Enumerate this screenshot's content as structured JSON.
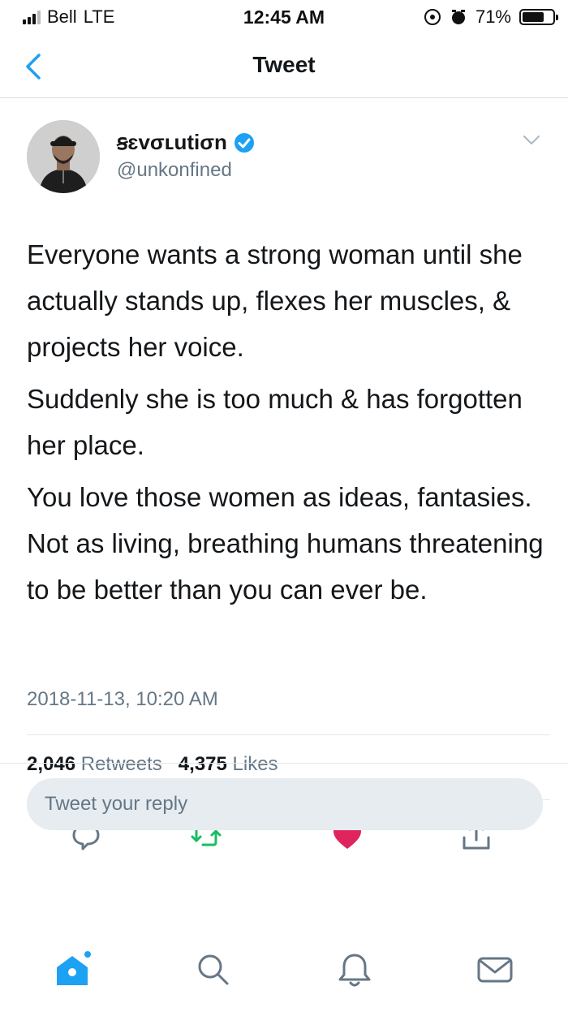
{
  "status_bar": {
    "carrier": "Bell",
    "network": "LTE",
    "time": "12:45 AM",
    "battery": "71%",
    "battery_level": 0.71
  },
  "nav": {
    "title": "Tweet",
    "back_icon": "chevron-left-icon"
  },
  "tweet": {
    "display_name": "ꞩɛvσʟutiσn",
    "handle": "@unkonfined",
    "verified": true,
    "paragraphs": [
      "Everyone wants a strong woman until she actually stands up, flexes her muscles, & projects her voice.",
      "Suddenly she is too much & has forgotten her place.",
      "You love those women as ideas, fantasies. Not as living, breathing humans threatening to be better than you can ever be."
    ],
    "timestamp": "2018-11-13, 10:20 AM",
    "retweets": {
      "count": "2,046",
      "label": "Retweets"
    },
    "likes": {
      "count": "4,375",
      "label": "Likes"
    }
  },
  "reply": {
    "placeholder": "Tweet your reply"
  },
  "colors": {
    "accent": "#1da1f2",
    "retweet": "#17bf63",
    "like": "#e0245e",
    "muted": "#657786"
  },
  "icons": [
    "reply-icon",
    "retweet-icon",
    "like-icon",
    "share-icon",
    "home-icon",
    "search-icon",
    "notifications-icon",
    "messages-icon"
  ]
}
